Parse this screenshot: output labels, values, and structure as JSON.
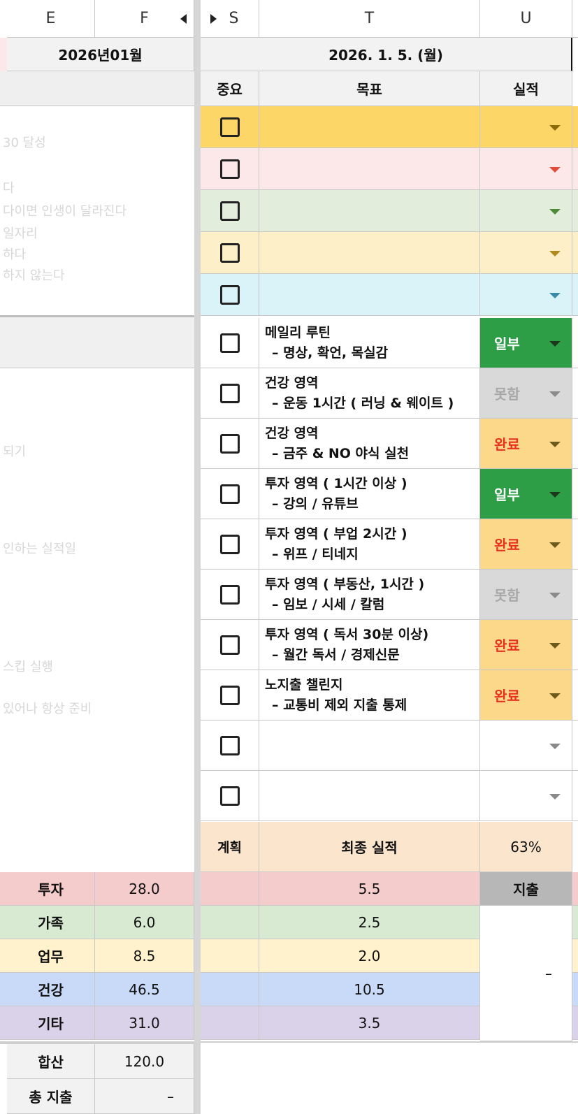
{
  "columns": {
    "e": "E",
    "f": "F",
    "s": "S",
    "t": "T",
    "u": "U"
  },
  "left_header": {
    "month": "2026년01월"
  },
  "right_header": {
    "date": "2026. 1. 5. (월)"
  },
  "table_header": {
    "importance": "중요",
    "goal": "목표",
    "result": "실적"
  },
  "left_faded_lines": [
    "30 달성",
    "다",
    "다이면 인생이 달라진다",
    "일자리",
    "하다",
    "하지 않는다",
    "되기",
    "인하는 실적일",
    "스킵 실행",
    "있어나 항상 준비"
  ],
  "rows": [
    {
      "bg": "#fcd667",
      "arrow": "#8a6a0a",
      "line1": "",
      "line2": "",
      "status": "",
      "status_color": "",
      "status_bg": ""
    },
    {
      "bg": "#fce8e8",
      "arrow": "#e04b3a",
      "line1": "",
      "line2": "",
      "status": "",
      "status_color": "",
      "status_bg": ""
    },
    {
      "bg": "#e2eedb",
      "arrow": "#4f8a3a",
      "line1": "",
      "line2": "",
      "status": "",
      "status_color": "",
      "status_bg": ""
    },
    {
      "bg": "#fdf0c9",
      "arrow": "#b08a1a",
      "line1": "",
      "line2": "",
      "status": "",
      "status_color": "",
      "status_bg": ""
    },
    {
      "bg": "#d9f3f9",
      "arrow": "#3a8aa8",
      "line1": "",
      "line2": "",
      "status": "",
      "status_color": "",
      "status_bg": ""
    },
    {
      "bg": "#ffffff",
      "arrow": "#1b3a1b",
      "line1": "메일리 루틴",
      "line2": "– 명상, 확언, 목실감",
      "status": "일부",
      "status_color": "#ffffff",
      "status_bg": "#2e9e46"
    },
    {
      "bg": "#ffffff",
      "arrow": "#8a8a8a",
      "line1": "건강 영역",
      "line2": "– 운동 1시간 ( 러닝 & 웨이트 )",
      "status": "못함",
      "status_color": "#a8a8a8",
      "status_bg": "#d9d9d9"
    },
    {
      "bg": "#ffffff",
      "arrow": "#6b5a1a",
      "line1": "건강 영역",
      "line2": "– 금주 & NO 야식 실천",
      "status": "완료",
      "status_color": "#e8321e",
      "status_bg": "#fcd98a"
    },
    {
      "bg": "#ffffff",
      "arrow": "#1b3a1b",
      "line1": "투자 영역 ( 1시간 이상 )",
      "line2": "– 강의 / 유튜브",
      "status": "일부",
      "status_color": "#ffffff",
      "status_bg": "#2e9e46"
    },
    {
      "bg": "#ffffff",
      "arrow": "#6b5a1a",
      "line1": "투자 영역 ( 부업 2시간 )",
      "line2": "– 위프 / 티네지",
      "status": "완료",
      "status_color": "#e8321e",
      "status_bg": "#fcd98a"
    },
    {
      "bg": "#ffffff",
      "arrow": "#8a8a8a",
      "line1": "투자 영역 ( 부동산, 1시간 )",
      "line2": "– 임보 / 시세 / 칼럼",
      "status": "못함",
      "status_color": "#a8a8a8",
      "status_bg": "#d9d9d9"
    },
    {
      "bg": "#ffffff",
      "arrow": "#6b5a1a",
      "line1": "투자 영역 ( 독서 30분 이상)",
      "line2": "– 월간 독서 / 경제신문",
      "status": "완료",
      "status_color": "#e8321e",
      "status_bg": "#fcd98a"
    },
    {
      "bg": "#ffffff",
      "arrow": "#6b5a1a",
      "line1": "노지출 챌린지",
      "line2": "– 교통비 제외 지출 통제",
      "status": "완료",
      "status_color": "#e8321e",
      "status_bg": "#fcd98a"
    },
    {
      "bg": "#ffffff",
      "arrow": "#8a8a8a",
      "line1": "",
      "line2": "",
      "status": "",
      "status_color": "",
      "status_bg": ""
    },
    {
      "bg": "#ffffff",
      "arrow": "#8a8a8a",
      "line1": "",
      "line2": "",
      "status": "",
      "status_color": "",
      "status_bg": ""
    }
  ],
  "summary": {
    "plan": "계획",
    "final_result": "최종 실적",
    "percent": "63%"
  },
  "categories": [
    {
      "name": "투자",
      "value_f": "28.0",
      "value_t": "5.5",
      "bg": "#f4cccc"
    },
    {
      "name": "가족",
      "value_f": "6.0",
      "value_t": "2.5",
      "bg": "#d9ead3"
    },
    {
      "name": "업무",
      "value_f": "8.5",
      "value_t": "2.0",
      "bg": "#fff2cc"
    },
    {
      "name": "건강",
      "value_f": "46.5",
      "value_t": "10.5",
      "bg": "#c9daf8"
    },
    {
      "name": "기타",
      "value_f": "31.0",
      "value_t": "3.5",
      "bg": "#d9d2e9"
    }
  ],
  "expense": {
    "label": "지출",
    "value": "–"
  },
  "totals": {
    "sum_label": "합산",
    "sum_value": "120.0",
    "total_expense_label": "총 지출",
    "total_expense_value": "–"
  },
  "colors": {
    "freeze": "#d6d6d6",
    "header_gray": "#f2f2f2",
    "summary_peach": "#fce5cd",
    "expense_gray": "#b7b7b7"
  }
}
